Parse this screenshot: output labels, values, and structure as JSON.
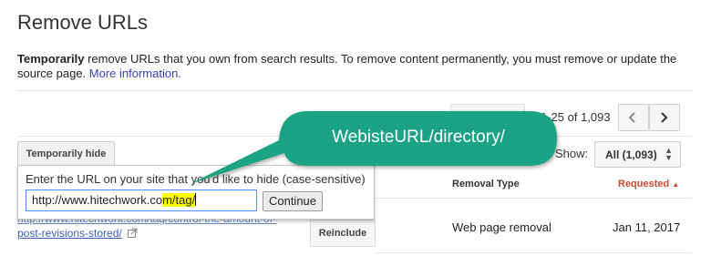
{
  "page": {
    "title": "Remove URLs",
    "description_bold": "Temporarily",
    "description_rest": " remove URLs that you own from search results. To remove content permanently, you must remove or update the source page. ",
    "more_info_link": "More information."
  },
  "pager": {
    "range": "1-25 of 1,093"
  },
  "toolbar": {
    "temporarily_hide_label": "Temporarily hide",
    "show_label": "Show:",
    "show_value": "All (1,093)"
  },
  "table": {
    "headers": {
      "removal_type": "Removal Type",
      "requested": "Requested",
      "sort_indicator": "▲"
    },
    "rows": [
      {
        "url_line1": "http://www.hitechwork.com/tag/control-the-amount-of-",
        "url_line2": "post-revisions-stored/",
        "action_label": "Reinclude",
        "removal_type": "Web page removal",
        "requested": "Jan 11, 2017"
      }
    ]
  },
  "popup": {
    "label": "Enter the URL on your site that you'd like to hide (case-sensitive)",
    "input_value_plain": "http://www.hitechwork.co",
    "input_value_highlight": "m/tag/",
    "continue_label": "Continue"
  },
  "callout": {
    "text": "WebisteURL/directory/",
    "color": "#1fa385"
  },
  "colors": {
    "accent": "#d14836",
    "link": "#3b5fbf",
    "focus": "#4d90fe"
  }
}
